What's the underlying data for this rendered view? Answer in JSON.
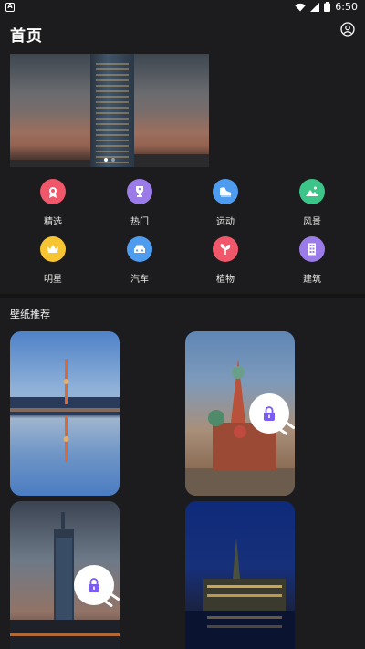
{
  "status_bar": {
    "time": "6:50"
  },
  "header": {
    "title": "首页"
  },
  "banner": {
    "dots": 2,
    "active_dot": 0
  },
  "categories": [
    {
      "label": "精选",
      "icon": "ribbon-icon",
      "color": "#f0576a"
    },
    {
      "label": "热门",
      "icon": "trophy-icon",
      "color": "#9b7be8"
    },
    {
      "label": "运动",
      "icon": "sneaker-icon",
      "color": "#4d9cf0"
    },
    {
      "label": "风景",
      "icon": "landscape-icon",
      "color": "#3cc489"
    },
    {
      "label": "明星",
      "icon": "crown-icon",
      "color": "#f7c531"
    },
    {
      "label": "汽车",
      "icon": "car-icon",
      "color": "#4d9cf0"
    },
    {
      "label": "植物",
      "icon": "sprout-icon",
      "color": "#f0576a"
    },
    {
      "label": "建筑",
      "icon": "building-icon",
      "color": "#9b7be8"
    }
  ],
  "section": {
    "title": "壁纸推荐"
  },
  "wallpapers": [
    {
      "name": "tv-tower-reflection",
      "locked": false
    },
    {
      "name": "st-basils-cathedral",
      "locked": true
    },
    {
      "name": "skyscraper-city",
      "locked": true
    },
    {
      "name": "night-town-hall",
      "locked": false
    }
  ]
}
